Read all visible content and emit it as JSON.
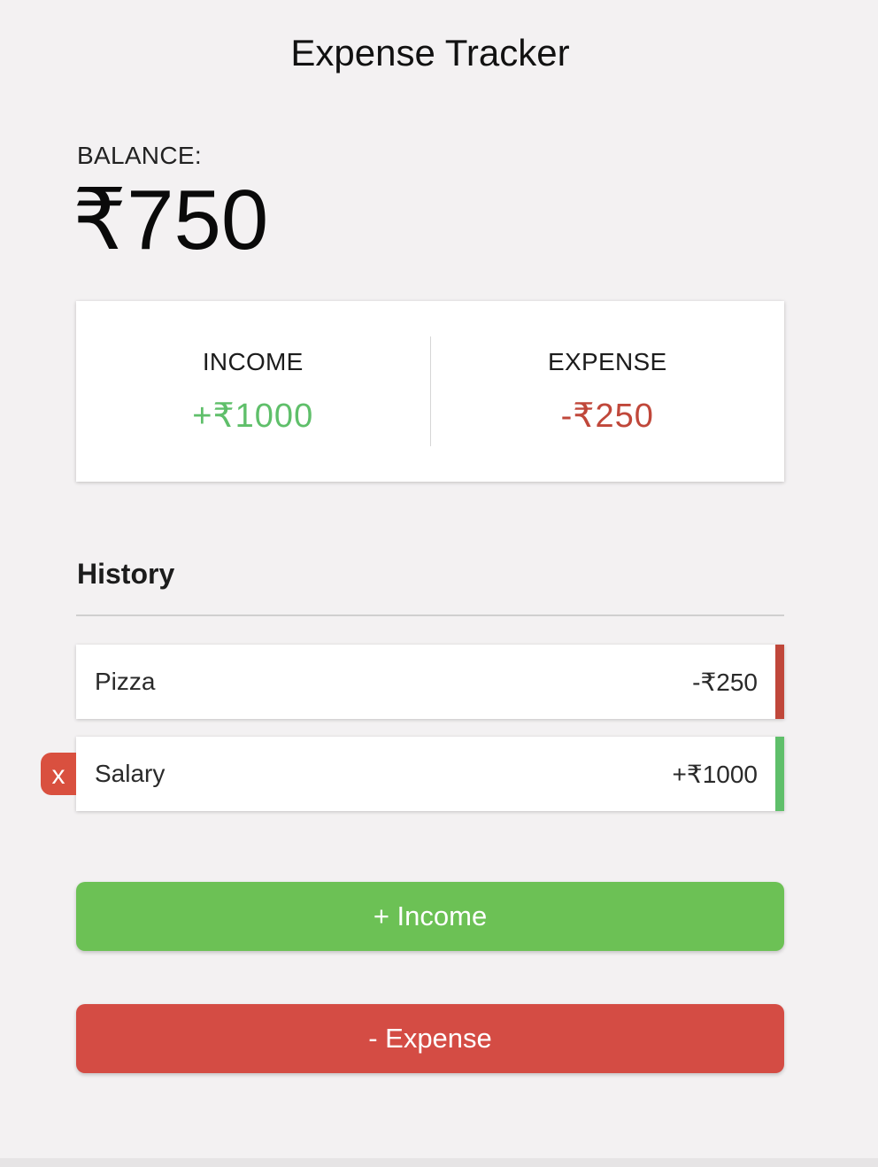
{
  "app": {
    "title": "Expense Tracker"
  },
  "balance": {
    "label": "BALANCE:",
    "value": "₹750"
  },
  "summary": {
    "income_label": "INCOME",
    "income_amount": "+₹1000",
    "expense_label": "EXPENSE",
    "expense_amount": "-₹250"
  },
  "history": {
    "title": "History",
    "items": [
      {
        "name": "Pizza",
        "amount": "-₹250",
        "type": "expense"
      },
      {
        "name": "Salary",
        "amount": "+₹1000",
        "type": "income"
      }
    ],
    "delete_label": "x"
  },
  "actions": {
    "income_button": "+ Income",
    "expense_button": "- Expense"
  },
  "colors": {
    "income": "#5fbf6a",
    "expense": "#c0473a",
    "income_button": "#6cc155",
    "expense_button": "#d44c44",
    "delete_button": "#d9503f"
  }
}
